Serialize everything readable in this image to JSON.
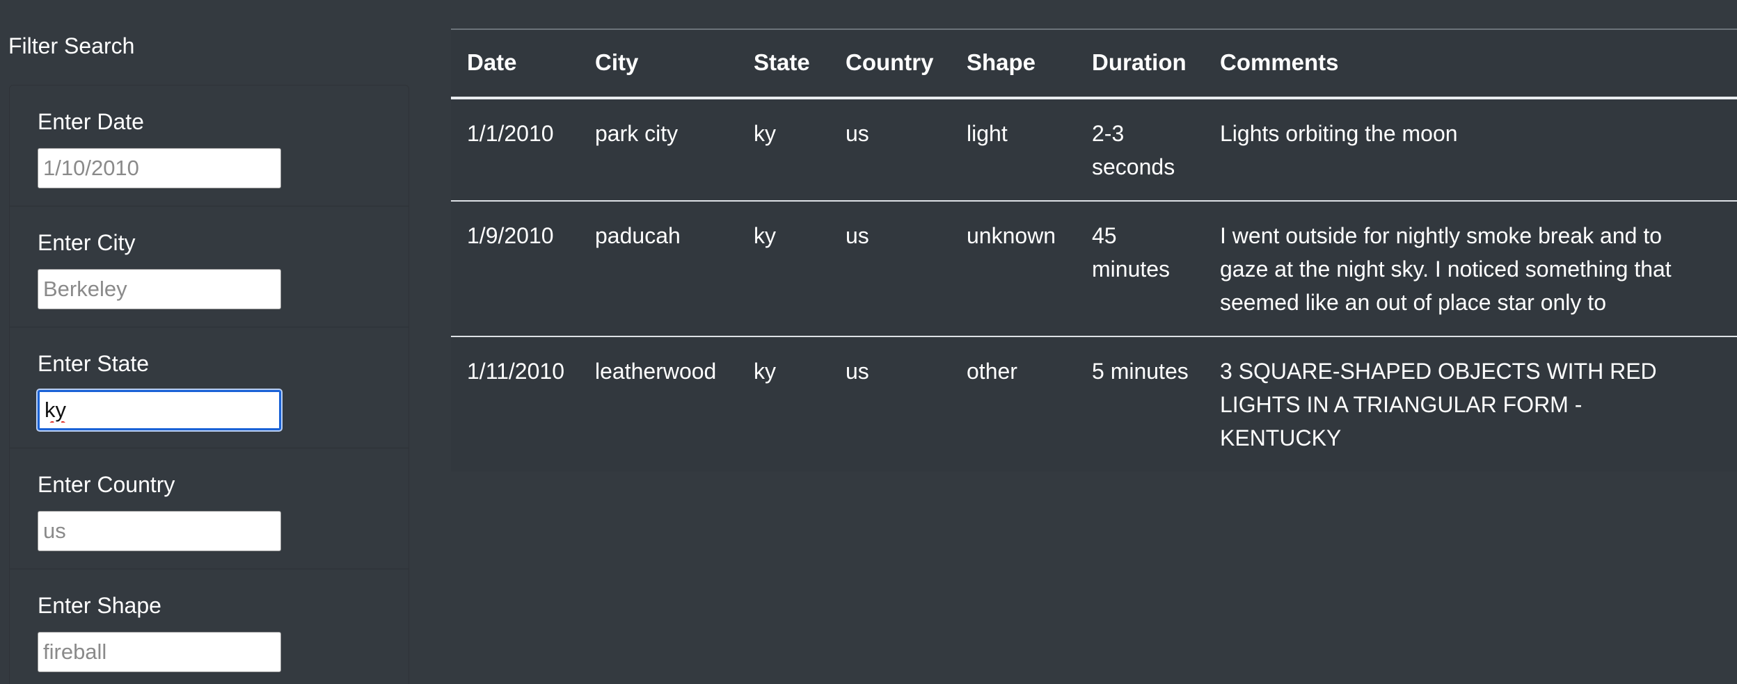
{
  "sidebar": {
    "title": "Filter Search",
    "filters": [
      {
        "label": "Enter Date",
        "value": "",
        "placeholder": "1/10/2010"
      },
      {
        "label": "Enter City",
        "value": "",
        "placeholder": "Berkeley"
      },
      {
        "label": "Enter State",
        "value": "ky",
        "placeholder": ""
      },
      {
        "label": "Enter Country",
        "value": "",
        "placeholder": "us"
      },
      {
        "label": "Enter Shape",
        "value": "",
        "placeholder": "fireball"
      }
    ]
  },
  "table": {
    "headers": [
      "Date",
      "City",
      "State",
      "Country",
      "Shape",
      "Duration",
      "Comments"
    ],
    "rows": [
      [
        "1/1/2010",
        "park city",
        "ky",
        "us",
        "light",
        "2-3 seconds",
        "Lights orbiting the moon"
      ],
      [
        "1/9/2010",
        "paducah",
        "ky",
        "us",
        "unknown",
        "45 minutes",
        "I went outside for nightly smoke break and to gaze at the night sky. I noticed something that seemed like an out of place star only to"
      ],
      [
        "1/11/2010",
        "leatherwood",
        "ky",
        "us",
        "other",
        "5 minutes",
        "3 SQUARE-SHAPED OBJECTS WITH RED LIGHTS IN A TRIANGULAR FORM - KENTUCKY"
      ]
    ]
  },
  "colors": {
    "background": "#343a40",
    "table_background": "#32383e",
    "focus_border": "#1a62d6",
    "text": "#ffffff"
  }
}
